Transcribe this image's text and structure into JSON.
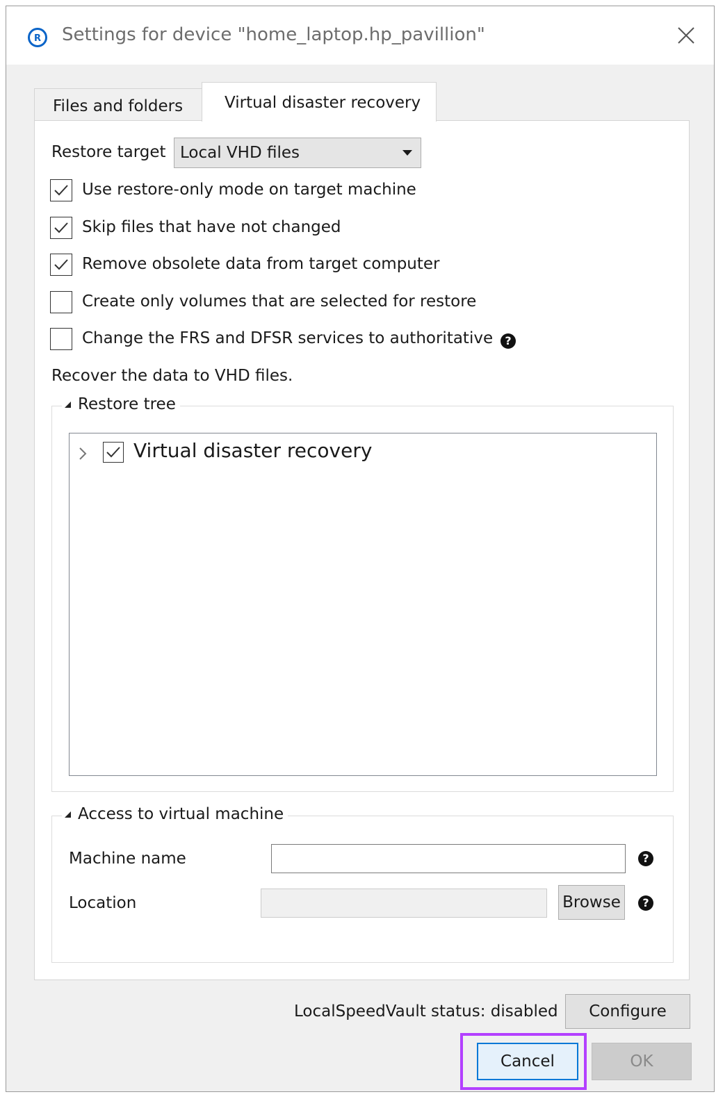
{
  "window": {
    "title": "Settings for device \"home_laptop.hp_pavillion\"",
    "app_icon_letter": "R"
  },
  "tabs": [
    {
      "label": "Files and folders",
      "active": false
    },
    {
      "label": "Virtual disaster recovery",
      "active": true
    }
  ],
  "restore_target": {
    "label": "Restore target",
    "selected": "Local VHD files"
  },
  "options": [
    {
      "label": "Use restore-only mode on target machine",
      "checked": true
    },
    {
      "label": "Skip files that have not changed",
      "checked": true
    },
    {
      "label": "Remove obsolete data from target computer",
      "checked": true
    },
    {
      "label": "Create only volumes that are selected for restore",
      "checked": false
    },
    {
      "label": "Change the FRS and DFSR services to authoritative",
      "checked": false
    }
  ],
  "info_text": "Recover the data to VHD files.",
  "restore_tree": {
    "legend": "Restore tree",
    "items": [
      {
        "label": "Virtual disaster recovery",
        "checked": true
      }
    ]
  },
  "vm_access": {
    "legend": "Access to virtual machine",
    "machine_name_label": "Machine name",
    "machine_name_value": "",
    "location_label": "Location",
    "location_value": "",
    "browse_label": "Browse"
  },
  "footer": {
    "status_text": "LocalSpeedVault status:  disabled",
    "configure_label": "Configure",
    "cancel_label": "Cancel",
    "ok_label": "OK"
  },
  "colors": {
    "highlight": "#b340ff",
    "focus": "#0078d7",
    "app_icon": "#0a64c8"
  }
}
